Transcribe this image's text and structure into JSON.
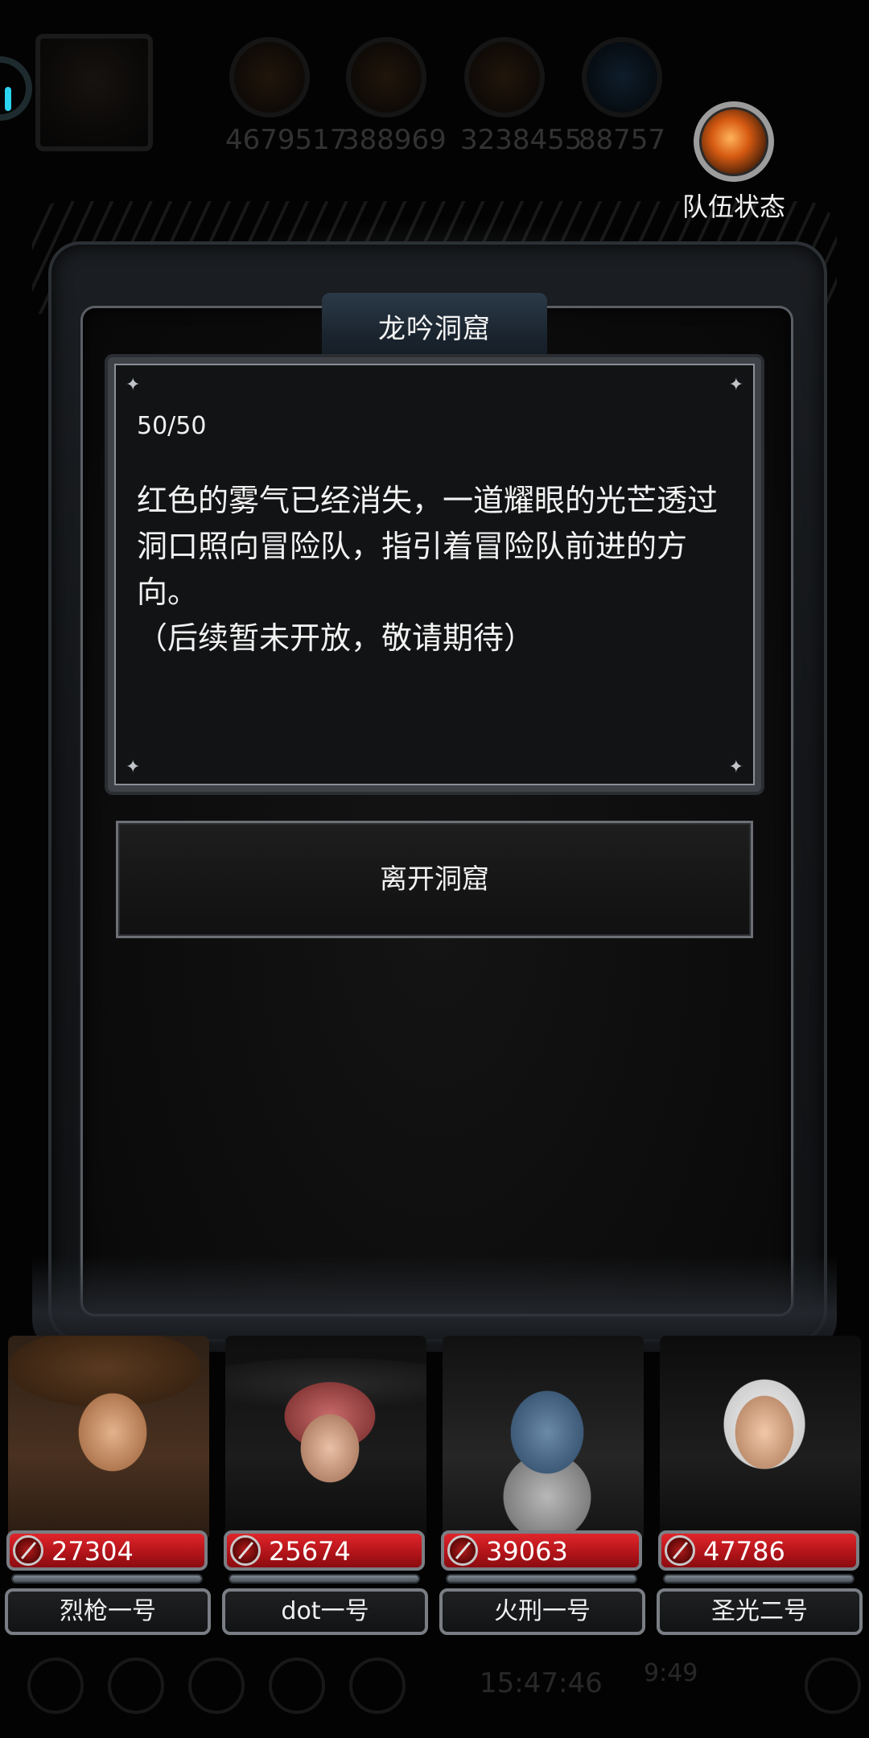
{
  "top": {
    "resources": [
      {
        "icon": "bread-icon",
        "value": "4679517"
      },
      {
        "icon": "wood-icon",
        "value": "388969"
      },
      {
        "icon": "iron-icon",
        "value": "3238455"
      },
      {
        "icon": "crystal-icon",
        "value": "88757"
      }
    ],
    "team_status": "队伍状态"
  },
  "dialog": {
    "title": "龙吟洞窟",
    "progress": "50/50",
    "story": "红色的雾气已经消失，一道耀眼的光芒透过洞口照向冒险队，指引着冒险队前进的方向。\n（后续暂未开放，敬请期待）",
    "leave_button": "离开洞窟"
  },
  "heroes": [
    {
      "name": "烈枪一号",
      "hp": "27304"
    },
    {
      "name": "dot一号",
      "hp": "25674"
    },
    {
      "name": "火刑一号",
      "hp": "39063"
    },
    {
      "name": "圣光二号",
      "hp": "47786"
    }
  ],
  "bottom": {
    "clock": "15:47:46",
    "clock2": "9:49"
  },
  "colors": {
    "hp_red": "#c8141a",
    "frame_gray": "#7a7e84",
    "title_plate": "#1a242e"
  }
}
